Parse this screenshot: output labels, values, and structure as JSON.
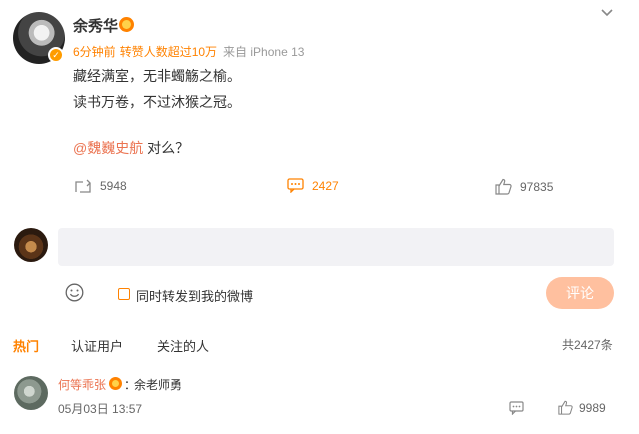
{
  "post": {
    "username": "余秀华",
    "meta": {
      "time": "6分钟前",
      "forward_count_text": "转赞人数超过10万",
      "source": "来自 iPhone 13"
    },
    "lines": [
      "藏经满室，无非蠋觞之榆。",
      "读书万卷，不过沐猴之冠。"
    ],
    "mention": "@魏巍史航",
    "mention_suffix": " 对么？",
    "icons": [
      "verified-badge",
      "vip-crown-icon",
      "chevron-down-icon"
    ]
  },
  "actions": {
    "repost": {
      "count": "5948",
      "icon": "repost-icon"
    },
    "comment": {
      "count": "2427",
      "icon": "comment-icon"
    },
    "like": {
      "count": "97835",
      "icon": "thumbs-up-icon"
    }
  },
  "compose": {
    "placeholder": "",
    "repost_label": "同时转发到我的微博",
    "submit_label": "评论"
  },
  "tabs": {
    "items": [
      "热门",
      "认证用户",
      "关注的人"
    ],
    "total": "共2427条"
  },
  "comment": {
    "username": "何等乖张",
    "separator": "：",
    "text": "余老师勇",
    "time": "05月03日 13:57",
    "like_count": "9989"
  },
  "colors": {
    "accent": "#ff8200",
    "mention": "#eb7350",
    "submit_disabled": "#ffc09f",
    "input_bg": "#f2f2f5"
  }
}
